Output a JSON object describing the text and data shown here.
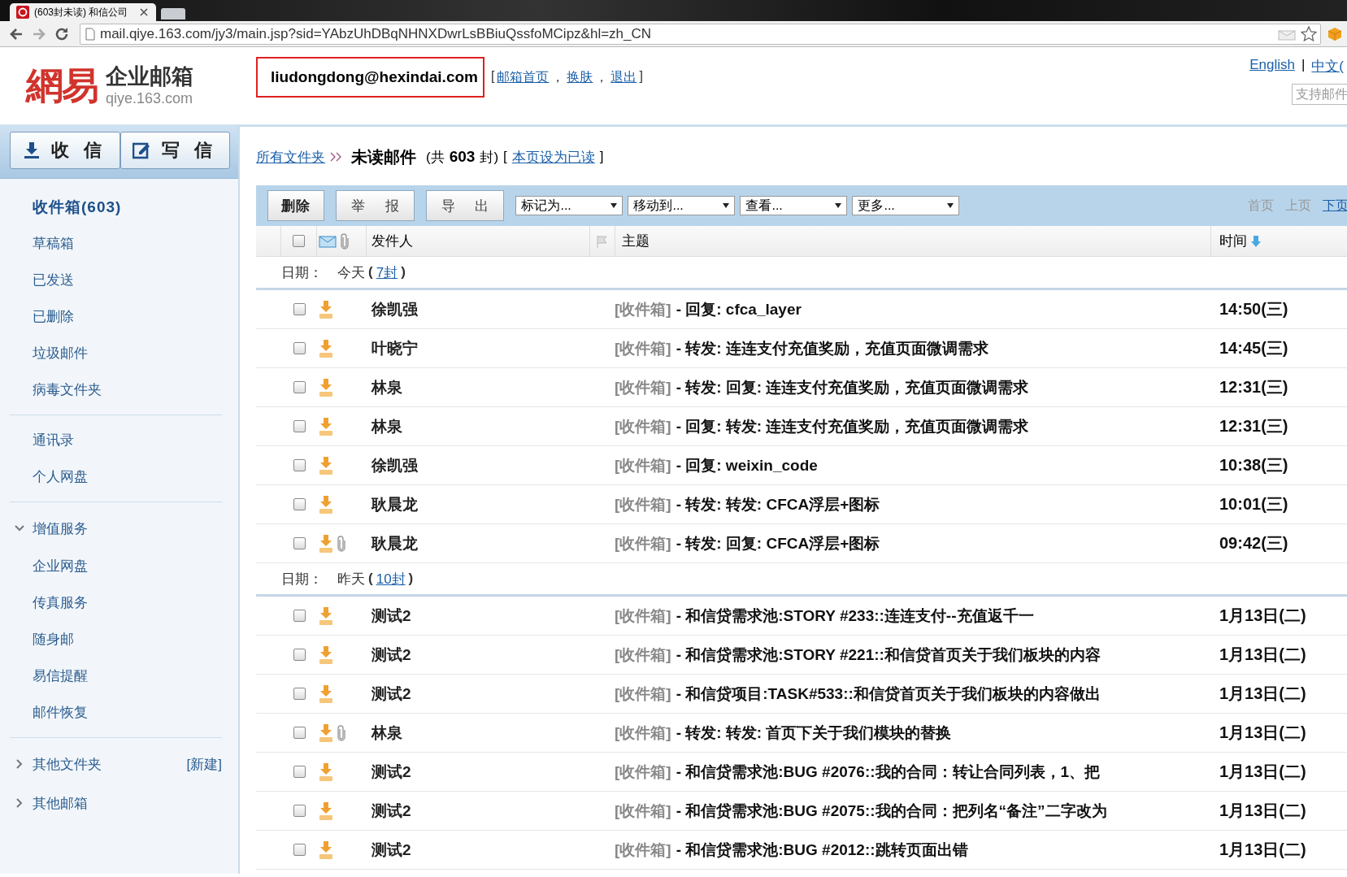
{
  "browser": {
    "tab_title": "(603封未读) 和信公司",
    "url": "mail.qiye.163.com/jy3/main.jsp?sid=YAbzUhDBqNHNXDwrLsBBiuQssfoMCipz&hl=zh_CN"
  },
  "header": {
    "logo_mark": "網易",
    "product": "企业邮箱",
    "domain": "qiye.163.com",
    "account": "liudongdong@hexindai.com",
    "links": {
      "open": "[",
      "close": "]",
      "items": [
        {
          "label": "邮箱首页",
          "after": "，"
        },
        {
          "label": "换肤",
          "after": "，"
        },
        {
          "label": "退出"
        }
      ]
    },
    "languages": [
      "English",
      "中文("
    ],
    "language_separator": "|",
    "search": {
      "placeholder": "支持邮件"
    }
  },
  "sidebar": {
    "buttons": [
      {
        "label": "收 信",
        "kind": "receive"
      },
      {
        "label": "写 信",
        "kind": "compose"
      }
    ],
    "sections": [
      {
        "kind": "list",
        "items": [
          {
            "label": "收件箱(603)",
            "selected": true
          },
          {
            "label": "草稿箱",
            "selected": false
          },
          {
            "label": "已发送",
            "selected": false
          },
          {
            "label": "已删除",
            "selected": false
          },
          {
            "label": "垃圾邮件",
            "selected": false
          },
          {
            "label": "病毒文件夹",
            "selected": false
          }
        ]
      },
      {
        "kind": "list",
        "items": [
          {
            "label": "通讯录",
            "selected": false
          },
          {
            "label": "个人网盘",
            "selected": false
          }
        ]
      },
      {
        "kind": "folder",
        "label": "增值服务",
        "expanded": true,
        "items": [
          {
            "label": "企业网盘",
            "selected": false
          },
          {
            "label": "传真服务",
            "selected": false
          },
          {
            "label": "随身邮",
            "selected": false
          },
          {
            "label": "易信提醒",
            "selected": false
          },
          {
            "label": "邮件恢复",
            "selected": false
          }
        ]
      },
      {
        "kind": "folders",
        "entries": [
          {
            "label": "其他文件夹",
            "expanded": false,
            "action": "[新建]"
          },
          {
            "label": "其他邮箱",
            "expanded": false
          }
        ]
      }
    ]
  },
  "breadcrumb": {
    "root": "所有文件夹",
    "current": "未读邮件",
    "count_open": "(共",
    "count": "603",
    "count_close": "封)",
    "mark_read": {
      "open": "[",
      "link": "本页设为已读",
      "close": "]"
    }
  },
  "toolbar": {
    "buttons": [
      {
        "label": "删除",
        "kind": "primary"
      },
      {
        "label": "举 报",
        "kind": "plain"
      },
      {
        "label": "导 出",
        "kind": "plain"
      }
    ],
    "dropdowns": [
      "标记为...",
      "移动到...",
      "查看...",
      "更多..."
    ],
    "pager": [
      {
        "label": "首页",
        "disabled": true
      },
      {
        "label": "上页",
        "disabled": true
      },
      {
        "label": "下页",
        "disabled": false
      }
    ]
  },
  "table": {
    "select_all": {
      "checked": false
    },
    "columns": {
      "sender": "发件人",
      "subject": "主题",
      "time": "时间"
    },
    "groups": [
      {
        "label": "日期：",
        "day": "今天",
        "open": "(",
        "count": "7封",
        "close": ")",
        "rows": [
          {
            "checked": false,
            "attachment": false,
            "sender": "徐凯强",
            "folder": "[收件箱]",
            "subject": "- 回复: cfca_layer",
            "time": "14:50(三)"
          },
          {
            "checked": false,
            "attachment": false,
            "sender": "叶晓宁",
            "folder": "[收件箱]",
            "subject": "- 转发: 连连支付充值奖励，充值页面微调需求",
            "time": "14:45(三)"
          },
          {
            "checked": false,
            "attachment": false,
            "sender": "林泉",
            "folder": "[收件箱]",
            "subject": "- 转发: 回复: 连连支付充值奖励，充值页面微调需求",
            "time": "12:31(三)"
          },
          {
            "checked": false,
            "attachment": false,
            "sender": "林泉",
            "folder": "[收件箱]",
            "subject": "- 回复: 转发: 连连支付充值奖励，充值页面微调需求",
            "time": "12:31(三)"
          },
          {
            "checked": false,
            "attachment": false,
            "sender": "徐凯强",
            "folder": "[收件箱]",
            "subject": "- 回复: weixin_code",
            "time": "10:38(三)"
          },
          {
            "checked": false,
            "attachment": false,
            "sender": "耿晨龙",
            "folder": "[收件箱]",
            "subject": "- 转发: 转发: CFCA浮层+图标",
            "time": "10:01(三)"
          },
          {
            "checked": false,
            "attachment": true,
            "sender": "耿晨龙",
            "folder": "[收件箱]",
            "subject": "- 转发: 回复: CFCA浮层+图标",
            "time": "09:42(三)"
          }
        ]
      },
      {
        "label": "日期：",
        "day": "昨天",
        "open": "(",
        "count": "10封",
        "close": ")",
        "rows": [
          {
            "checked": false,
            "attachment": false,
            "sender": "测试2",
            "folder": "[收件箱]",
            "subject": "- 和信贷需求池:STORY #233::连连支付--充值返千一",
            "time": "1月13日(二)"
          },
          {
            "checked": false,
            "attachment": false,
            "sender": "测试2",
            "folder": "[收件箱]",
            "subject": "- 和信贷需求池:STORY #221::和信贷首页关于我们板块的内容",
            "time": "1月13日(二)"
          },
          {
            "checked": false,
            "attachment": false,
            "sender": "测试2",
            "folder": "[收件箱]",
            "subject": "- 和信贷项目:TASK#533::和信贷首页关于我们板块的内容做出",
            "time": "1月13日(二)"
          },
          {
            "checked": false,
            "attachment": true,
            "sender": "林泉",
            "folder": "[收件箱]",
            "subject": "- 转发: 转发: 首页下关于我们模块的替换",
            "time": "1月13日(二)"
          },
          {
            "checked": false,
            "attachment": false,
            "sender": "测试2",
            "folder": "[收件箱]",
            "subject": "- 和信贷需求池:BUG #2076::我的合同：转让合同列表，1、把",
            "time": "1月13日(二)"
          },
          {
            "checked": false,
            "attachment": false,
            "sender": "测试2",
            "folder": "[收件箱]",
            "subject": "- 和信贷需求池:BUG #2075::我的合同：把列名“备注”二字改为",
            "time": "1月13日(二)"
          },
          {
            "checked": false,
            "attachment": false,
            "sender": "测试2",
            "folder": "[收件箱]",
            "subject": "- 和信贷需求池:BUG #2012::跳转页面出错",
            "time": "1月13日(二)"
          }
        ]
      }
    ]
  }
}
